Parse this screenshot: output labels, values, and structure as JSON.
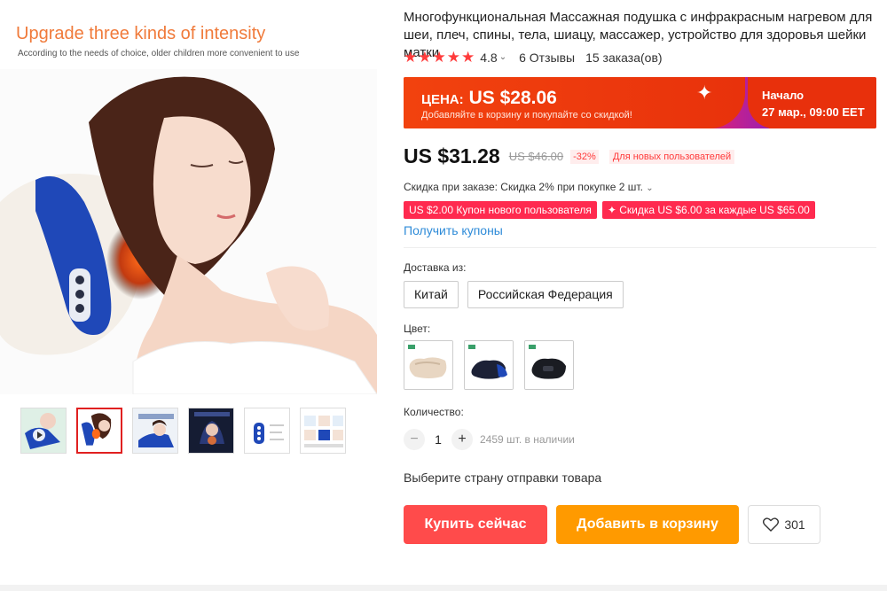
{
  "gallery": {
    "promo_title": "Upgrade three kinds of intensity",
    "promo_subtitle": "According to the needs of choice, older children more convenient to use",
    "thumbnails": [
      {
        "name": "thumb-video",
        "active": false
      },
      {
        "name": "thumb-neck",
        "active": true
      },
      {
        "name": "thumb-lying",
        "active": false
      },
      {
        "name": "thumb-dark",
        "active": false
      },
      {
        "name": "thumb-controls",
        "active": false
      },
      {
        "name": "thumb-grid",
        "active": false
      }
    ]
  },
  "product": {
    "title": "Многофункциональная Массажная подушка с инфракрасным нагревом для шеи, плеч, спины, тела, шиацу, массажер, устройство для здоровья шейки матки",
    "rating": "4.8",
    "reviews": "6 Отзывы",
    "orders": "15 заказа(ов)"
  },
  "sale_banner": {
    "label": "ЦЕНА:",
    "price": "US $28.06",
    "note": "Добавляйте в корзину и покупайте со скидкой!",
    "starts_label": "Начало",
    "starts_date": "27 мар., 09:00 EET"
  },
  "price": {
    "current": "US $31.28",
    "old": "US $46.00",
    "discount": "-32%",
    "new_user": "Для новых пользователей"
  },
  "promotions": {
    "order_discount": "Скидка при заказе: Скидка 2% при покупке 2 шт.",
    "coupons": [
      "US $2.00 Купон нового пользователя",
      "✦ Скидка US $6.00 за каждые US $65.00"
    ],
    "get_coupons": "Получить купоны"
  },
  "shipping": {
    "label": "Доставка из:",
    "options": [
      "Китай",
      "Российская Федерация"
    ]
  },
  "color": {
    "label": "Цвет:"
  },
  "quantity": {
    "label": "Количество:",
    "value": "1",
    "stock": "2459 шт. в наличии"
  },
  "ship_country_prompt": "Выберите страну отправки товара",
  "actions": {
    "buy_now": "Купить сейчас",
    "add_to_cart": "Добавить в корзину",
    "wishlist_count": "301"
  },
  "colors": {
    "accent_red": "#ff4b4b",
    "accent_orange": "#ff9a00",
    "banner_red": "#e8300c",
    "link_blue": "#2e8bd8"
  }
}
